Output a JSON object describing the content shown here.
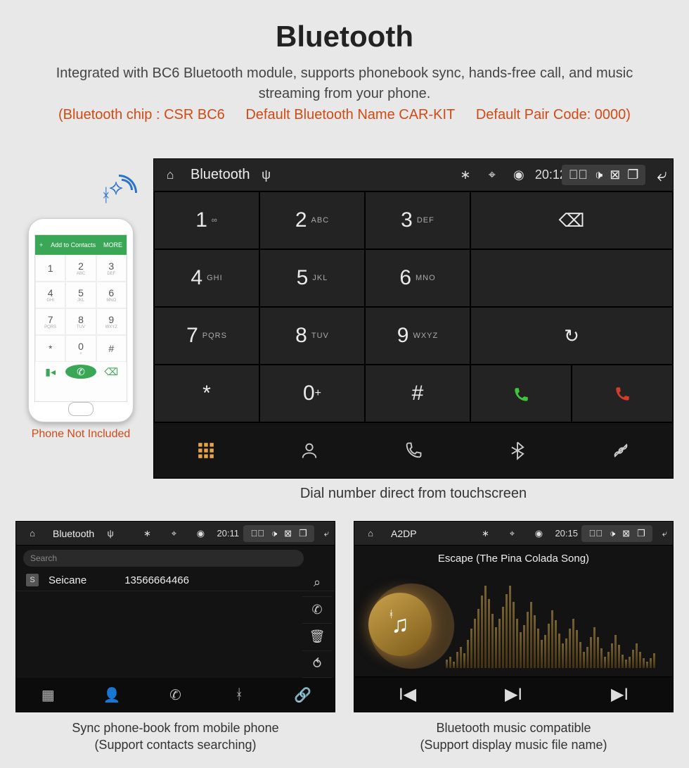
{
  "page": {
    "title": "Bluetooth",
    "description": "Integrated with BC6 Bluetooth module, supports phonebook sync, hands-free call, and music streaming from your phone.",
    "spec_chip": "(Bluetooth chip : CSR BC6",
    "spec_name": "Default Bluetooth Name CAR-KIT",
    "spec_code": "Default Pair Code: 0000)"
  },
  "phone_mock": {
    "top_left_icon": "+",
    "top_label": "Add to Contacts",
    "top_more": "MORE",
    "caption": "Phone Not Included",
    "keys": [
      {
        "n": "1",
        "s": ""
      },
      {
        "n": "2",
        "s": "ABC"
      },
      {
        "n": "3",
        "s": "DEF"
      },
      {
        "n": "4",
        "s": "GHI"
      },
      {
        "n": "5",
        "s": "JKL"
      },
      {
        "n": "6",
        "s": "MNO"
      },
      {
        "n": "7",
        "s": "PQRS"
      },
      {
        "n": "8",
        "s": "TUV"
      },
      {
        "n": "9",
        "s": "WXYZ"
      },
      {
        "n": "*",
        "s": ""
      },
      {
        "n": "0",
        "s": "+"
      },
      {
        "n": "#",
        "s": ""
      }
    ]
  },
  "dialer": {
    "status": {
      "title": "Bluetooth",
      "time": "20:12"
    },
    "caption": "Dial number direct from touchscreen",
    "keys": [
      {
        "n": "1",
        "s": "∞"
      },
      {
        "n": "2",
        "s": "ABC"
      },
      {
        "n": "3",
        "s": "DEF"
      },
      {
        "n": "4",
        "s": "GHI"
      },
      {
        "n": "5",
        "s": "JKL"
      },
      {
        "n": "6",
        "s": "MNO"
      },
      {
        "n": "7",
        "s": "PQRS"
      },
      {
        "n": "8",
        "s": "TUV"
      },
      {
        "n": "9",
        "s": "WXYZ"
      },
      {
        "n": "*",
        "s": ""
      },
      {
        "n": "0",
        "s": "+",
        "plus_up": true
      },
      {
        "n": "#",
        "s": ""
      }
    ]
  },
  "phonebook": {
    "status": {
      "title": "Bluetooth",
      "time": "20:11"
    },
    "search_placeholder": "Search",
    "contact_badge": "S",
    "contact_name": "Seicane",
    "contact_number": "13566664466",
    "caption_l1": "Sync phone-book from mobile phone",
    "caption_l2": "(Support contacts searching)"
  },
  "a2dp": {
    "status": {
      "title": "A2DP",
      "time": "20:15"
    },
    "track": "Escape (The Pina Colada Song)",
    "caption_l1": "Bluetooth music compatible",
    "caption_l2": "(Support display music file name)"
  }
}
